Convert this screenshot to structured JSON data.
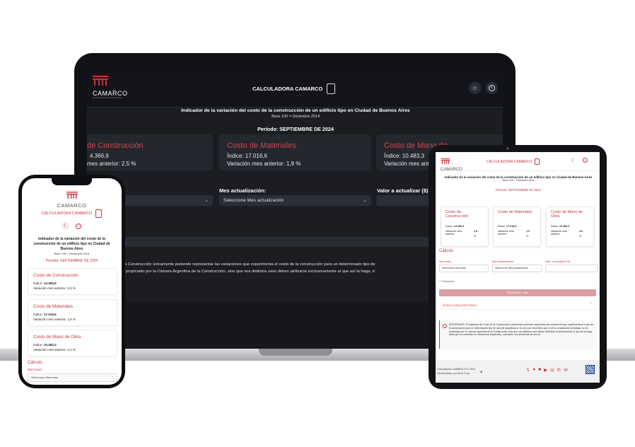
{
  "brand": {
    "name": "CAMARCO",
    "tagline": "Cámara Argentina de la Construcción"
  },
  "header": {
    "title": "CALCULADORA CAMARCO"
  },
  "intro": {
    "heading": "Indicador de la variación del costo de la construcción de un edificio tipo en Ciudad de Buenos Aires",
    "base": "Base 100 = Diciembre 2014",
    "period": "Período: SEPTIEMBRE DE 2024"
  },
  "cards": [
    {
      "title": "Costo de Construcción",
      "indice": "Índice: 14.366,9",
      "variacion": "Variación mes anterior: 2,5 %",
      "indice_label": "Índice:",
      "indice_value": "14.366,9",
      "var_label": "Variación mes anterior:",
      "var_value": "2,5",
      "var_unit": "%"
    },
    {
      "title": "Costo de Materiales",
      "indice": "Índice: 17.016,6",
      "variacion": "Variación mes anterior: 1,9 %",
      "indice_label": "Índice:",
      "indice_value": "17.016,6",
      "var_label": "Variación mes anterior:",
      "var_value": "1,9",
      "var_unit": "%"
    },
    {
      "title": "Costo de Mano de Obra",
      "indice": "Índice: 10.483,3",
      "variacion": "Variación mes anterior: 4,0 %",
      "indice_label": "Índice:",
      "indice_value": "10.483,3",
      "var_label": "Variación mes anterior:",
      "var_value": "4,0",
      "var_unit": "%"
    }
  ],
  "laptop_cards_partial": [
    {
      "title": "de Construcción",
      "indice": "4.366,9",
      "variacion": "mes anterior: 2,5 %"
    },
    {
      "title": "Costo de Mano de",
      "indice": "Índice: 10.483,3",
      "variacion": "Variación mes anter"
    }
  ],
  "calc": {
    "title": "Cálculo",
    "mes_base_label": "Mes base:",
    "mes_base_placeholder": "Seleccione Mes base",
    "mes_act_label": "Mes actualización:",
    "mes_act_placeholder": "Seleccione Mes actualización",
    "valor_label": "Valor a actualizar ($):",
    "provision_label": "Provisoria",
    "button": "Actualizar Valor"
  },
  "model": {
    "label": "MODELO ARQUITECTÓNICO"
  },
  "notice": {
    "text": "IMPORTANTE: El Indicador del Costo de la Construcción únicamente pretende representar las variaciones que experimenta el costo de la construcción para un determinado tipo de obra de arquitectura. Su uso con otros fines que el de la comparación señalada, no es propiciado por la Cámara Argentina de la Construcción, sino que sus distintos usos deben atribuirse exclusivamente al que así la haga, dado que su contenido es meramente estadístico, marcando una tendencia del sector.",
    "laptop_line1": "icador del Costo de la Construcción únicamente pretende representar las variaciones que experimenta el costo de la construcción para un determinado tipo de",
    "laptop_line2": "ción señalada, no es propiciado por la Cámara Argentina de la Construcción, sino que sus distintos usos deben atribuirse exclusivamente al que así la haga, d",
    "laptop_line3": "cia del sector."
  },
  "footer": {
    "copyright": "Calculadora CAMARCO © 2024",
    "developed": "Desarrollado por Bool Corp"
  },
  "colors": {
    "accent": "#c7333f",
    "laptop_bg": "#1b1d22",
    "tablet_button": "#d99da2"
  },
  "icons": [
    "calculator-icon",
    "sun-icon",
    "info-icon",
    "moon-icon",
    "twitter-icon",
    "facebook-icon",
    "linkedin-icon",
    "youtube-icon",
    "instagram-icon",
    "phone-icon",
    "mail-icon",
    "qr-icon"
  ]
}
